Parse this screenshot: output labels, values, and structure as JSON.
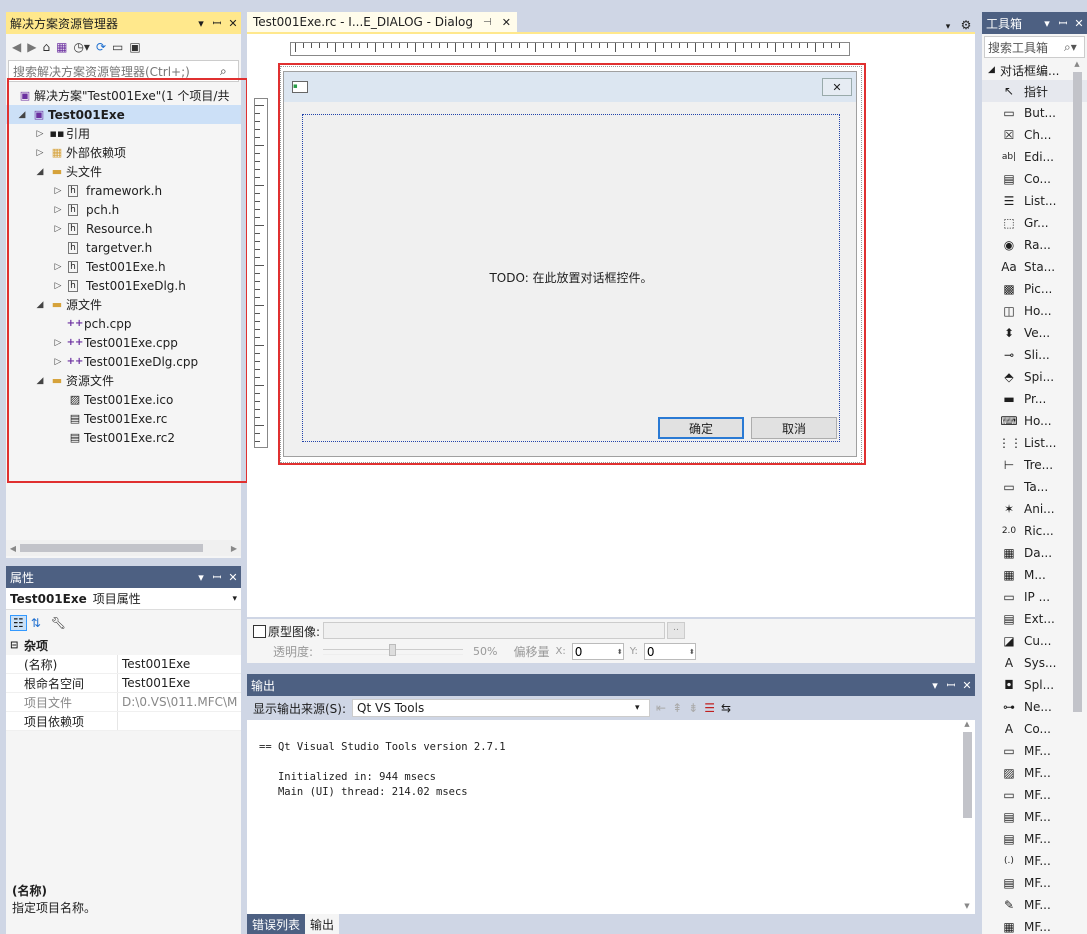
{
  "solution_explorer": {
    "title": "解决方案资源管理器",
    "search_placeholder": "搜索解决方案资源管理器(Ctrl+;)",
    "solution_label": "解决方案\"Test001Exe\"(1 个项目/共",
    "project": "Test001Exe",
    "items": [
      {
        "label": "引用",
        "indent": 2,
        "expander": "▷",
        "icon": "references-icon",
        "glyph": "▪▪"
      },
      {
        "label": "外部依赖项",
        "indent": 2,
        "expander": "▷",
        "icon": "external-deps-icon",
        "glyph": "▦"
      },
      {
        "label": "头文件",
        "indent": 2,
        "expander": "◢",
        "icon": "folder-icon",
        "glyph": "▬"
      },
      {
        "label": "framework.h",
        "indent": 3,
        "expander": "▷",
        "icon": "header-file-icon",
        "glyph": "h"
      },
      {
        "label": "pch.h",
        "indent": 3,
        "expander": "▷",
        "icon": "header-file-icon",
        "glyph": "h"
      },
      {
        "label": "Resource.h",
        "indent": 3,
        "expander": "▷",
        "icon": "header-file-icon",
        "glyph": "h"
      },
      {
        "label": "targetver.h",
        "indent": 3,
        "expander": "",
        "icon": "header-file-icon",
        "glyph": "h"
      },
      {
        "label": "Test001Exe.h",
        "indent": 3,
        "expander": "▷",
        "icon": "header-file-icon",
        "glyph": "h"
      },
      {
        "label": "Test001ExeDlg.h",
        "indent": 3,
        "expander": "▷",
        "icon": "header-file-icon",
        "glyph": "h"
      },
      {
        "label": "源文件",
        "indent": 2,
        "expander": "◢",
        "icon": "folder-icon",
        "glyph": "▬"
      },
      {
        "label": "pch.cpp",
        "indent": 3,
        "expander": "",
        "icon": "cpp-file-icon",
        "glyph": "++"
      },
      {
        "label": "Test001Exe.cpp",
        "indent": 3,
        "expander": "▷",
        "icon": "cpp-file-icon",
        "glyph": "++"
      },
      {
        "label": "Test001ExeDlg.cpp",
        "indent": 3,
        "expander": "▷",
        "icon": "cpp-file-icon",
        "glyph": "++"
      },
      {
        "label": "资源文件",
        "indent": 2,
        "expander": "◢",
        "icon": "folder-icon",
        "glyph": "▬"
      },
      {
        "label": "Test001Exe.ico",
        "indent": 3,
        "expander": "",
        "icon": "image-file-icon",
        "glyph": "▨"
      },
      {
        "label": "Test001Exe.rc",
        "indent": 3,
        "expander": "",
        "icon": "resource-file-icon",
        "glyph": "▤"
      },
      {
        "label": "Test001Exe.rc2",
        "indent": 3,
        "expander": "",
        "icon": "resource-file-icon",
        "glyph": "▤"
      }
    ]
  },
  "properties": {
    "title": "属性",
    "object_name": "Test001Exe",
    "object_type": "项目属性",
    "category": "杂项",
    "rows": [
      {
        "key": "(名称)",
        "value": "Test001Exe",
        "grey": false
      },
      {
        "key": "根命名空间",
        "value": "Test001Exe",
        "grey": false
      },
      {
        "key": "项目文件",
        "value": "D:\\0.VS\\011.MFC\\M",
        "grey": true
      },
      {
        "key": "项目依赖项",
        "value": "",
        "grey": false
      }
    ],
    "desc_title": "(名称)",
    "desc_text": "指定项目名称。"
  },
  "editor": {
    "tab_title": "Test001Exe.rc - I...E_DIALOG - Dialog",
    "dialog_text": "TODO: 在此放置对话框控件。",
    "ok_label": "确定",
    "cancel_label": "取消",
    "prototype_label": "原型图像:",
    "opacity_label": "透明度:",
    "opacity_value": "50%",
    "offset_label": "偏移量",
    "x_label": "X:",
    "x_value": "0",
    "y_label": "Y:",
    "y_value": "0",
    "browse_label": ".."
  },
  "output": {
    "title": "输出",
    "source_label": "显示输出来源(S):",
    "source_value": "Qt VS Tools",
    "lines": [
      "== Qt Visual Studio Tools version 2.7.1",
      "",
      "   Initialized in: 944 msecs",
      "   Main (UI) thread: 214.02 msecs"
    ],
    "tabs": [
      "错误列表",
      "输出"
    ]
  },
  "toolbox": {
    "title": "工具箱",
    "search_placeholder": "搜索工具箱",
    "group": "对话框编...",
    "items": [
      {
        "label": "指针",
        "icon": "pointer-icon",
        "glyph": "↖"
      },
      {
        "label": "But...",
        "icon": "button-tool-icon",
        "glyph": "▭"
      },
      {
        "label": "Ch...",
        "icon": "checkbox-tool-icon",
        "glyph": "☒"
      },
      {
        "label": "Edi...",
        "icon": "edit-tool-icon",
        "glyph": "ab|"
      },
      {
        "label": "Co...",
        "icon": "combobox-tool-icon",
        "glyph": "▤"
      },
      {
        "label": "List...",
        "icon": "listbox-tool-icon",
        "glyph": "☰"
      },
      {
        "label": "Gr...",
        "icon": "groupbox-tool-icon",
        "glyph": "⬚"
      },
      {
        "label": "Ra...",
        "icon": "radio-tool-icon",
        "glyph": "◉"
      },
      {
        "label": "Sta...",
        "icon": "static-text-tool-icon",
        "glyph": "Aa"
      },
      {
        "label": "Pic...",
        "icon": "picture-tool-icon",
        "glyph": "▩"
      },
      {
        "label": "Ho...",
        "icon": "hscroll-tool-icon",
        "glyph": "◫"
      },
      {
        "label": "Ve...",
        "icon": "vscroll-tool-icon",
        "glyph": "⬍"
      },
      {
        "label": "Sli...",
        "icon": "slider-tool-icon",
        "glyph": "⊸"
      },
      {
        "label": "Spi...",
        "icon": "spin-tool-icon",
        "glyph": "⬘"
      },
      {
        "label": "Pr...",
        "icon": "progress-tool-icon",
        "glyph": "▬"
      },
      {
        "label": "Ho...",
        "icon": "hotkey-tool-icon",
        "glyph": "⌨"
      },
      {
        "label": "List...",
        "icon": "listctrl-tool-icon",
        "glyph": "⋮⋮"
      },
      {
        "label": "Tre...",
        "icon": "tree-tool-icon",
        "glyph": "⊢"
      },
      {
        "label": "Ta...",
        "icon": "tab-tool-icon",
        "glyph": "▭"
      },
      {
        "label": "Ani...",
        "icon": "animate-tool-icon",
        "glyph": "✶"
      },
      {
        "label": "Ric...",
        "icon": "richedit-tool-icon",
        "glyph": "2.0"
      },
      {
        "label": "Da...",
        "icon": "datetime-tool-icon",
        "glyph": "▦"
      },
      {
        "label": "M...",
        "icon": "monthcal-tool-icon",
        "glyph": "▦"
      },
      {
        "label": "IP ...",
        "icon": "ip-tool-icon",
        "glyph": "▭"
      },
      {
        "label": "Ext...",
        "icon": "extcombo-tool-icon",
        "glyph": "▤"
      },
      {
        "label": "Cu...",
        "icon": "custom-tool-icon",
        "glyph": "◪"
      },
      {
        "label": "Sys...",
        "icon": "syslink-tool-icon",
        "glyph": "A"
      },
      {
        "label": "Spl...",
        "icon": "split-tool-icon",
        "glyph": "◘"
      },
      {
        "label": "Ne...",
        "icon": "netaddr-tool-icon",
        "glyph": "⊶"
      },
      {
        "label": "Co...",
        "icon": "commandlink-tool-icon",
        "glyph": "A"
      },
      {
        "label": "MF...",
        "icon": "mfc-tool-icon",
        "glyph": "▭"
      },
      {
        "label": "MF...",
        "icon": "mfc-tool-icon",
        "glyph": "▨"
      },
      {
        "label": "MF...",
        "icon": "mfc-tool-icon",
        "glyph": "▭"
      },
      {
        "label": "MF...",
        "icon": "mfc-tool-icon",
        "glyph": "▤"
      },
      {
        "label": "MF...",
        "icon": "mfc-tool-icon",
        "glyph": "▤"
      },
      {
        "label": "MF...",
        "icon": "mfc-tool-icon",
        "glyph": "(.)"
      },
      {
        "label": "MF...",
        "icon": "mfc-tool-icon",
        "glyph": "▤"
      },
      {
        "label": "MF...",
        "icon": "mfc-tool-icon",
        "glyph": "✎"
      },
      {
        "label": "MF...",
        "icon": "mfc-tool-icon",
        "glyph": "▦"
      }
    ]
  }
}
